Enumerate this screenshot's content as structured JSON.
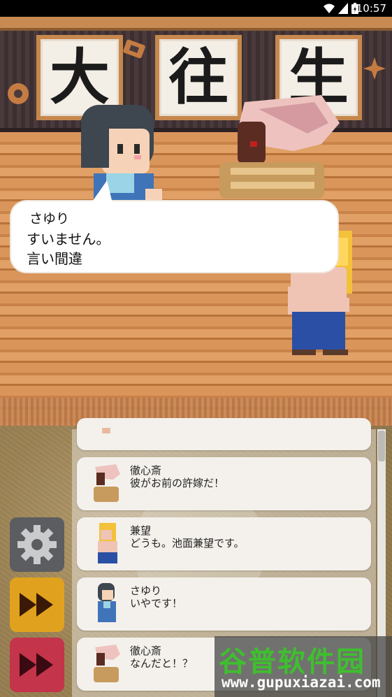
{
  "status_bar": {
    "time": "10:57",
    "icons": [
      "wifi-icon",
      "signal-icon",
      "battery-charging-icon"
    ]
  },
  "scene": {
    "banners": [
      "大",
      "往",
      "生"
    ],
    "characters": [
      "sayuri",
      "tesshinsai",
      "kenbou"
    ]
  },
  "dialogue": {
    "speaker": "さゆり",
    "lines": [
      "すいません。",
      "言い間違"
    ]
  },
  "log": {
    "entries": [
      {
        "speaker": "徹心斎",
        "text": "彼がお前の許嫁だ！",
        "portrait": "tesshinsai"
      },
      {
        "speaker": "兼望",
        "text": "どうも。池面兼望です。",
        "portrait": "kenbou"
      },
      {
        "speaker": "さゆり",
        "text": "いやです！",
        "portrait": "sayuri"
      },
      {
        "speaker": "徹心斎",
        "text": "なんだと！？",
        "portrait": "tesshinsai"
      }
    ]
  },
  "buttons": {
    "settings": {
      "icon": "gear-icon",
      "color": "#5b5d60"
    },
    "fast_forward": {
      "icon": "fast-forward-icon",
      "color": "#e0a21e"
    },
    "skip": {
      "icon": "skip-icon",
      "color": "#c4344a"
    }
  },
  "watermark": {
    "title": "谷普软件园",
    "url": "www.gupuxiazai.com"
  }
}
